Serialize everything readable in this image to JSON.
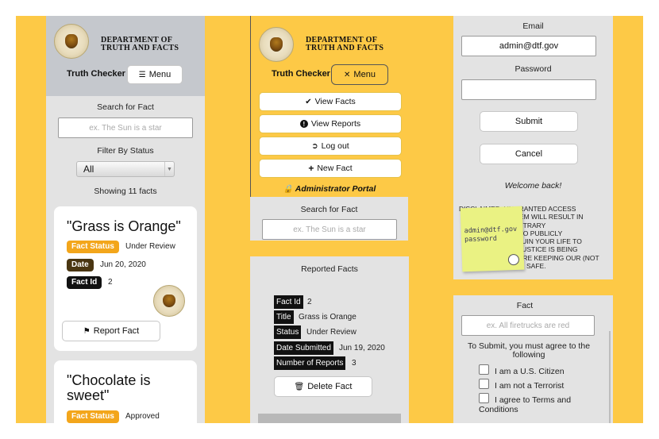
{
  "dept_name_line1": "DEPARTMENT OF",
  "dept_name_line2": "TRUTH AND FACTS",
  "brand": "Truth Checker",
  "colors": {
    "background": "#fdc946",
    "panel": "#e3e3e3",
    "header": "#c5c8cd",
    "fact_status_badge": "#f3a61b",
    "date_badge": "#4a3612",
    "fact_id_badge": "#111111"
  },
  "panel1": {
    "menu_label": "Menu",
    "menu_icon": "hamburger-icon",
    "search_label": "Search for Fact",
    "search_placeholder": "ex. The Sun is a star",
    "filter_label": "Filter By Status",
    "filter_value": "All",
    "showing": "Showing 11 facts",
    "cards": [
      {
        "title": "\"Grass is Orange\"",
        "status_label": "Fact Status",
        "status": "Under Review",
        "date_label": "Date",
        "date": "Jun 20, 2020",
        "id_label": "Fact Id",
        "id": "2",
        "report_label": "Report Fact"
      },
      {
        "title_line1": "\"Chocolate is",
        "title_line2": "sweet\"",
        "status_label": "Fact Status",
        "status": "Approved"
      }
    ]
  },
  "panel2": {
    "menu_label": "Menu",
    "menu_icon": "close-icon",
    "nav": [
      {
        "label": "View Facts",
        "icon": "check-icon"
      },
      {
        "label": "View Reports",
        "icon": "alert-icon"
      },
      {
        "label": "Log out",
        "icon": "logout-icon"
      },
      {
        "label": "New Fact",
        "icon": "plus-icon"
      }
    ],
    "portal": "Administrator Portal",
    "search_label": "Search for Fact",
    "search_placeholder": "ex. The Sun is a star"
  },
  "panel3": {
    "title": "Reported Facts",
    "rows": [
      {
        "key": "Fact Id",
        "value": "2"
      },
      {
        "key": "Title",
        "value": "Grass is Orange"
      },
      {
        "key": "Status",
        "value": "Under Review"
      },
      {
        "key": "Date Submitted",
        "value": "Jun 19, 2020"
      },
      {
        "key": "Number of Reports",
        "value": "3"
      }
    ],
    "delete_label": "Delete Fact"
  },
  "panel4": {
    "email_label": "Email",
    "email_value": "admin@dtf.gov",
    "password_label": "Password",
    "submit_label": "Submit",
    "cancel_label": "Cancel",
    "welcome": "Welcome back!",
    "disclaimer_lines": [
      "DISCLAIMER: UNGRANTED ACCESS",
      "OF THIS SYSTEM WILL RESULT IN",
      "AND/OR ABITRARY",
      "IN ORDER TO PUBLICLY",
      "OR RUIN YOUR LIFE TO",
      "JUSTICE IS BEING",
      "WE'RE KEEPING OUR (NOT",
      "SAFE."
    ],
    "sticky_note": [
      "admin@dtf.gov",
      "password"
    ]
  },
  "panel5": {
    "fact_label": "Fact",
    "fact_placeholder": "ex. All firetrucks are red",
    "agree_text": "To Submit, you must agree to the following",
    "checks": [
      "I am a U.S. Citizen",
      "I am not a Terrorist",
      "I agree to Terms and Conditions"
    ]
  }
}
